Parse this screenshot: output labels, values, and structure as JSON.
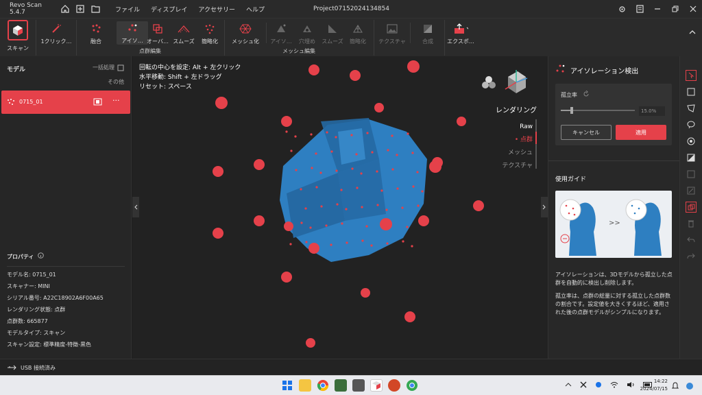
{
  "app": {
    "title": "Revo Scan 5.4.7",
    "project": "Project07152024134854"
  },
  "menu": [
    "ファイル",
    "ディスプレイ",
    "アクセサリー",
    "ヘルプ"
  ],
  "toolbar": {
    "scan": "スキャン",
    "one_click": "1クリック…",
    "fusion": "融合",
    "isolation": "アイソ…",
    "overlap": "オーバ…",
    "smooth": "スムーズ",
    "simplify": "簡略化",
    "meshing": "メッシュ化",
    "m_isolation": "アイソ…",
    "fill_holes": "穴埋め",
    "m_smooth": "スムーズ",
    "m_simplify": "簡略化",
    "texture": "テクスチャ",
    "merge": "合成",
    "export": "エクスポ…",
    "group_point": "点群編集",
    "group_mesh": "メッシュ編集"
  },
  "left": {
    "title": "モデル",
    "batch": "一括処理",
    "other": "その他",
    "model_name": "0715_01",
    "props_title": "プロパティ",
    "props": [
      "モデル名:  0715_01",
      "スキャナー:  MINI",
      "シリアル番号:  A22C18902A6F00A65",
      "レンダリング状態:  点群",
      "点群数:  665877",
      "モデルタイプ:  スキャン",
      "スキャン設定:  標準精度-特徴-黒色"
    ]
  },
  "viewport": {
    "hints": [
      "回転の中心を設定: Alt + 左クリック",
      "水平移動: Shift + 左ドラッグ",
      "リセット: スペース"
    ],
    "render_title": "レンダリング",
    "render_modes": [
      "Raw",
      "点群",
      "メッシュ",
      "テクスチャ"
    ],
    "render_active": "点群"
  },
  "right": {
    "title": "アイソレーション検出",
    "rate_label": "孤立率",
    "rate_value": "15.0%",
    "rate_fraction": 0.15,
    "cancel": "キャンセル",
    "apply": "適用",
    "guide_title": "使用ガイド",
    "desc1": "アイソレーションは、3Dモデルから孤立した点群を自動的に検出し削除します。",
    "desc2": "孤立率は、点群の総量に対する孤立した点群数の割合です。設定値を大きくするほど、適用された後の点群モデルがシンプルになります。"
  },
  "status": {
    "usb": "USB 接続済み"
  },
  "taskbar": {
    "time": "14:22",
    "date": "2024/07/15"
  },
  "colors": {
    "accent": "#e5414a",
    "model_blue": "#2e7fc1"
  }
}
